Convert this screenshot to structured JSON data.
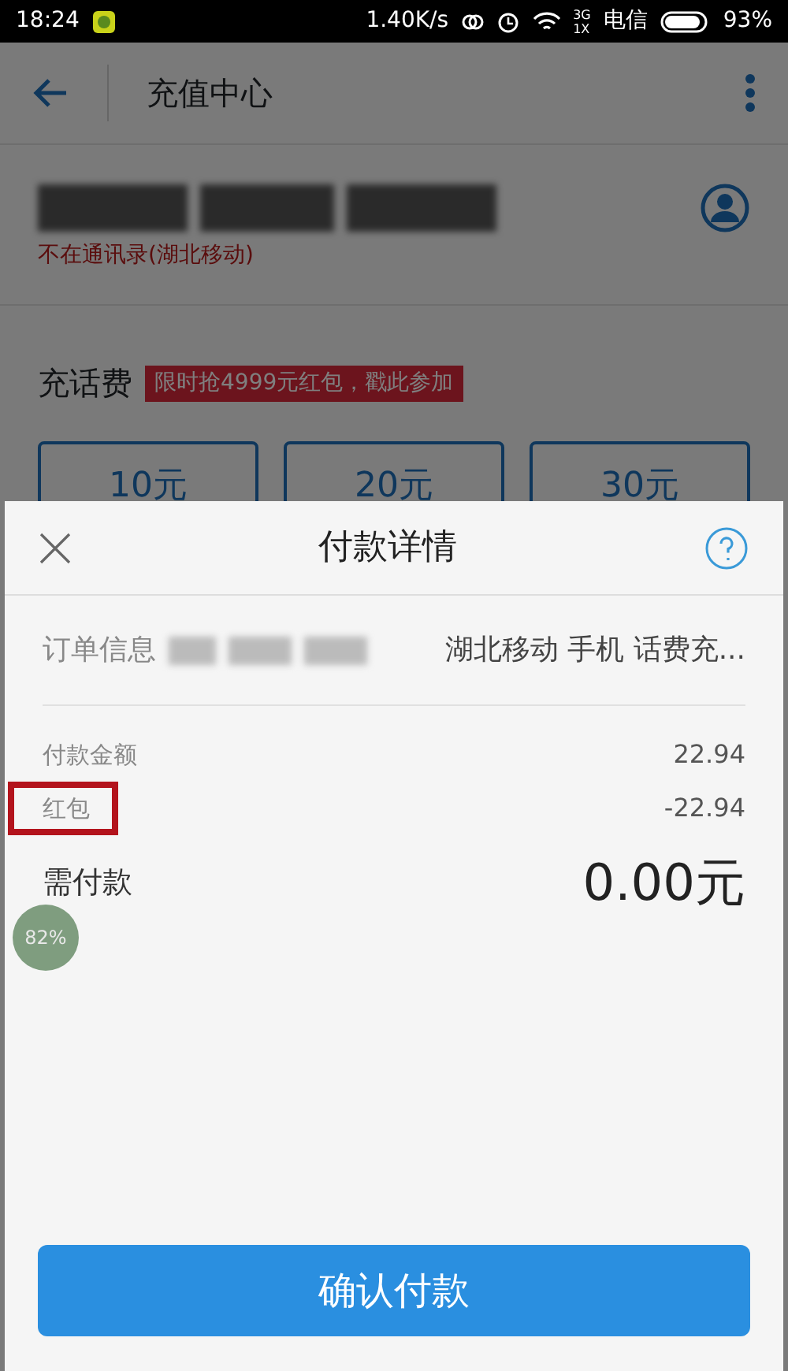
{
  "status_bar": {
    "time": "18:24",
    "speed": "1.40K/s",
    "network": "3G",
    "network_sub": "1X",
    "carrier": "电信",
    "battery": "93%"
  },
  "background_page": {
    "title": "充值中心",
    "contact_note": "不在通讯录(湖北移动)",
    "section": "充话费",
    "promo": "限时抢4999元红包，戳此参加",
    "amounts": [
      "10元",
      "20元",
      "30元"
    ]
  },
  "payment_sheet": {
    "title": "付款详情",
    "order_label": "订单信息",
    "order_value": "湖北移动 手机 话费充...",
    "rows": [
      {
        "label": "付款金额",
        "value": "22.94",
        "highlighted": false
      },
      {
        "label": "红包",
        "value": "-22.94",
        "highlighted": true
      }
    ],
    "total_label": "需付款",
    "total_value": "0.00元",
    "confirm_button": "确认付款"
  },
  "floating_ball": {
    "text": "82%"
  }
}
